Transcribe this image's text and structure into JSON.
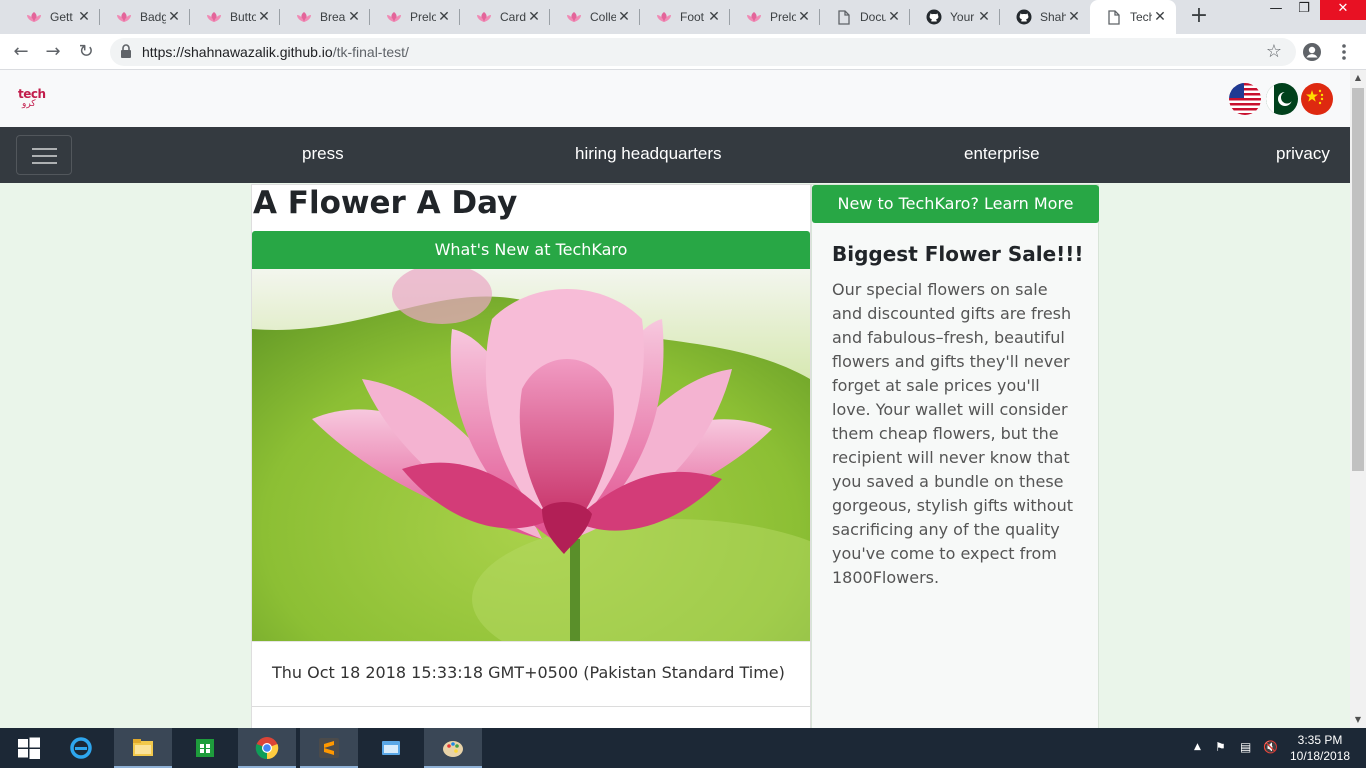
{
  "browser": {
    "tabs": [
      {
        "title": "Gett",
        "icon": "lotus-icon"
      },
      {
        "title": "Badg",
        "icon": "lotus-icon"
      },
      {
        "title": "Butto",
        "icon": "lotus-icon"
      },
      {
        "title": "Brea",
        "icon": "lotus-icon"
      },
      {
        "title": "Prelo",
        "icon": "lotus-icon"
      },
      {
        "title": "Card",
        "icon": "lotus-icon"
      },
      {
        "title": "Colle",
        "icon": "lotus-icon"
      },
      {
        "title": "Foot",
        "icon": "lotus-icon"
      },
      {
        "title": "Prelo",
        "icon": "lotus-icon"
      },
      {
        "title": "Docu",
        "icon": "document-icon"
      },
      {
        "title": "Your",
        "icon": "github-icon"
      },
      {
        "title": "Shah",
        "icon": "github-icon"
      },
      {
        "title": "Tech",
        "icon": "document-icon",
        "active": true
      }
    ],
    "url_host": "https://shahnawazalik.github.io",
    "url_path": "/tk-final-test/"
  },
  "site": {
    "logo_text_top": "tech",
    "logo_text_bottom": "کرو",
    "flags": [
      "us-flag",
      "pakistan-flag",
      "china-flag"
    ],
    "nav_links": [
      "press",
      "hiring headquarters",
      "enterprise",
      "privacy"
    ],
    "main": {
      "title": "A Flower A Day",
      "banner": "What's New at TechKaro",
      "date": "Thu Oct 18 2018 15:33:18 GMT+0500 (Pakistan Standard Time)"
    },
    "sidebar": {
      "button": "New to TechKaro? Learn More",
      "heading": "Biggest Flower Sale!!!",
      "text": "Our special flowers on sale and discounted gifts are fresh and fabulous–fresh, beautiful flowers and gifts they'll never forget at sale prices you'll love. Your wallet will consider them cheap flowers, but the recipient will never know that you saved a bundle on these gorgeous, stylish gifts without sacrificing any of the quality you've come to expect from 1800Flowers."
    }
  },
  "taskbar": {
    "time": "3:35 PM",
    "date": "10/18/2018"
  },
  "colors": {
    "accent_green": "#28a745",
    "nav_dark": "#343a40",
    "page_bg": "#eaf5ea",
    "taskbar": "#1c2836"
  }
}
